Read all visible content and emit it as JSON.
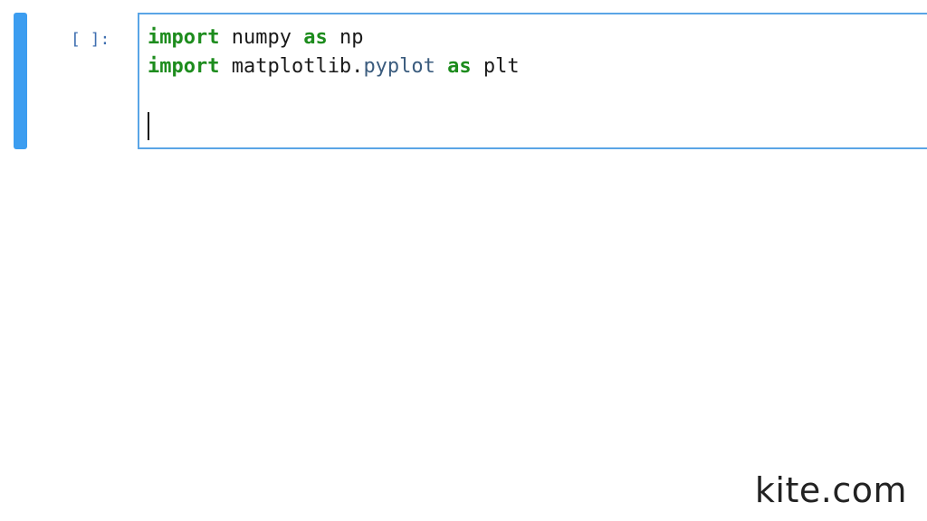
{
  "cell": {
    "prompt": "[ ]:",
    "lines": [
      [
        {
          "text": "import",
          "kind": "keyword"
        },
        {
          "text": " numpy ",
          "kind": "name"
        },
        {
          "text": "as",
          "kind": "keyword"
        },
        {
          "text": " np",
          "kind": "name"
        }
      ],
      [
        {
          "text": "import",
          "kind": "keyword"
        },
        {
          "text": " matplotlib.",
          "kind": "name"
        },
        {
          "text": "pyplot",
          "kind": "attribute"
        },
        {
          "text": " ",
          "kind": "name"
        },
        {
          "text": "as",
          "kind": "keyword"
        },
        {
          "text": " plt",
          "kind": "name"
        }
      ],
      []
    ]
  },
  "watermark": {
    "text": "kite.com"
  },
  "colors": {
    "collapser": "#3c9df0",
    "editor_border": "#5aa5e6",
    "keyword": "#1d8c1d",
    "attribute": "#3b5c7e",
    "prompt": "#3f6fb0"
  }
}
